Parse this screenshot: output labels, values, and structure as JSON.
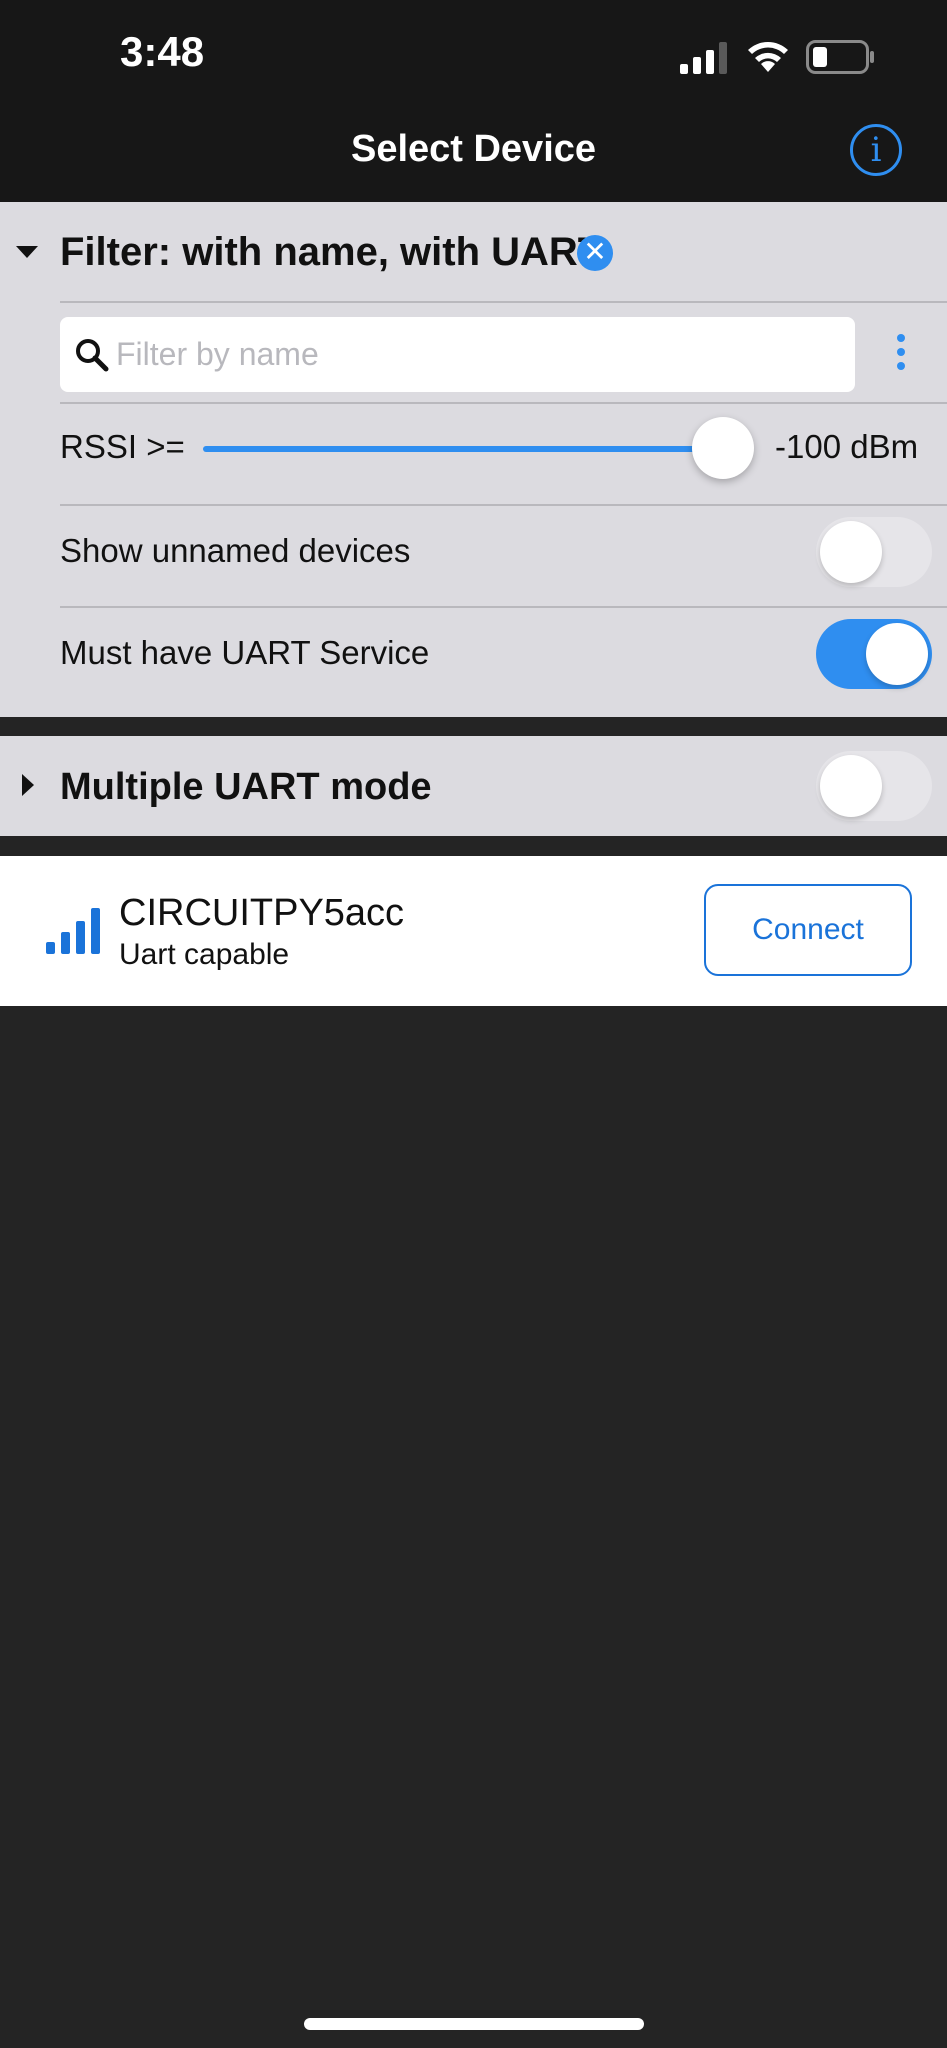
{
  "status_bar": {
    "time": "3:48"
  },
  "nav": {
    "title": "Select Device",
    "info_icon": "info-icon",
    "info_glyph": "i"
  },
  "filter": {
    "title": "Filter: with name, with UART",
    "clear_glyph": "✕",
    "search_placeholder": "Filter by name",
    "search_value": "",
    "rssi_label": "RSSI >=",
    "rssi_value_text": "-100 dBm",
    "rssi_slider_fraction": 1.0,
    "show_unnamed_label": "Show unnamed devices",
    "show_unnamed_on": false,
    "must_have_uart_label": "Must have UART Service",
    "must_have_uart_on": true
  },
  "multi_uart": {
    "title": "Multiple UART mode",
    "enabled": false
  },
  "devices": [
    {
      "name": "CIRCUITPY5acc",
      "subtitle": "Uart capable",
      "signal_icon": "signal-bars-icon",
      "connect_label": "Connect"
    }
  ],
  "colors": {
    "accent": "#2f8ef0",
    "panel_bg": "#dcdbe0",
    "bar_bg": "#171717",
    "screen_bg": "#242424"
  }
}
